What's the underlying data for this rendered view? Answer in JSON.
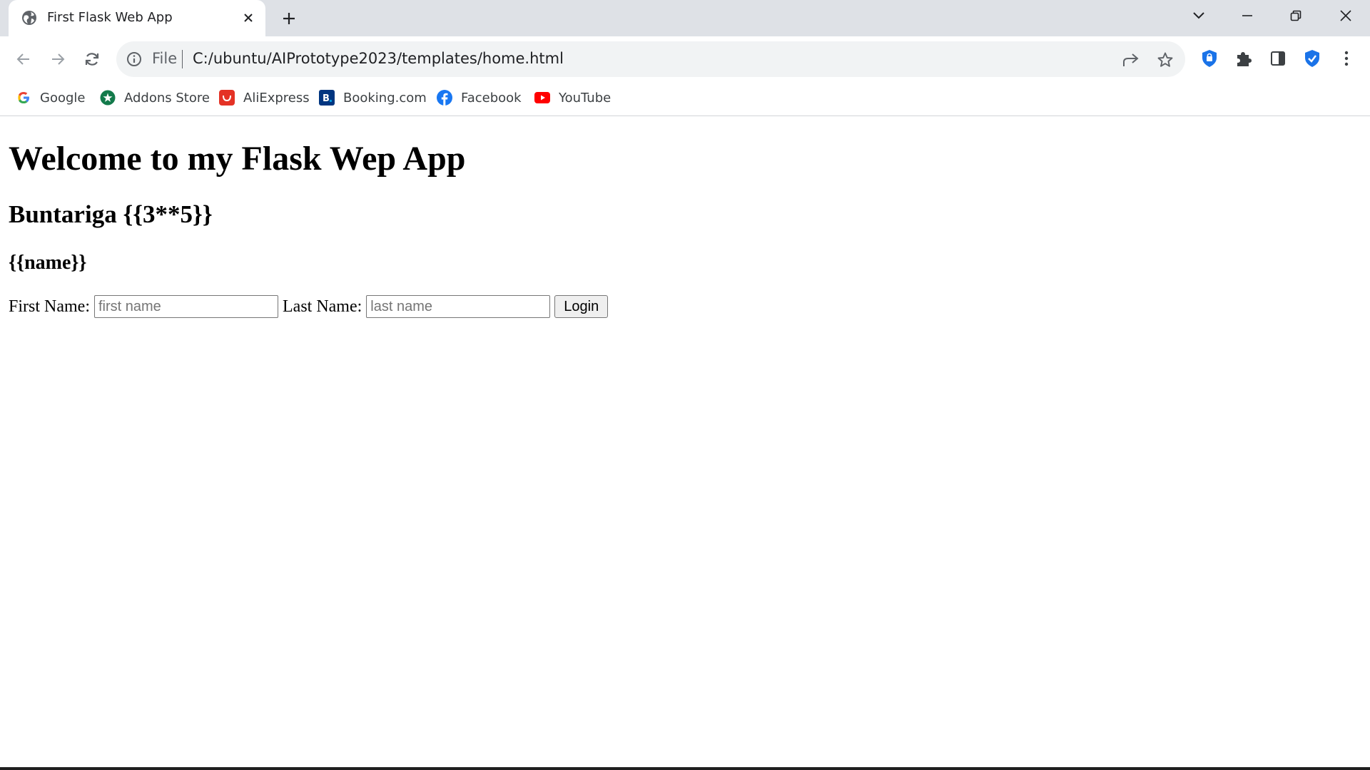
{
  "browser": {
    "tab": {
      "title": "First Flask Web App",
      "favicon": "globe-icon"
    },
    "address_bar": {
      "scheme_label": "File",
      "url": "C:/ubuntu/AIPrototype2023/templates/home.html"
    },
    "bookmarks": [
      {
        "label": "Google",
        "icon": "google-icon"
      },
      {
        "label": "Addons Store",
        "icon": "addons-store-icon"
      },
      {
        "label": "AliExpress",
        "icon": "aliexpress-icon"
      },
      {
        "label": "Booking.com",
        "icon": "booking-icon"
      },
      {
        "label": "Facebook",
        "icon": "facebook-icon"
      },
      {
        "label": "YouTube",
        "icon": "youtube-icon"
      }
    ],
    "colors": {
      "tabstrip": "#dee1e6",
      "omnibox": "#f1f3f4",
      "accent_blue": "#1a73e8"
    }
  },
  "page": {
    "h1": "Welcome to my Flask Wep App",
    "h2": "Buntariga {{3**5}}",
    "h3": "{{name}}",
    "form": {
      "first_name_label": "First Name:",
      "first_name_placeholder": "first name",
      "first_name_value": "",
      "last_name_label": "Last Name:",
      "last_name_placeholder": "last name",
      "last_name_value": "",
      "submit_label": "Login"
    }
  }
}
